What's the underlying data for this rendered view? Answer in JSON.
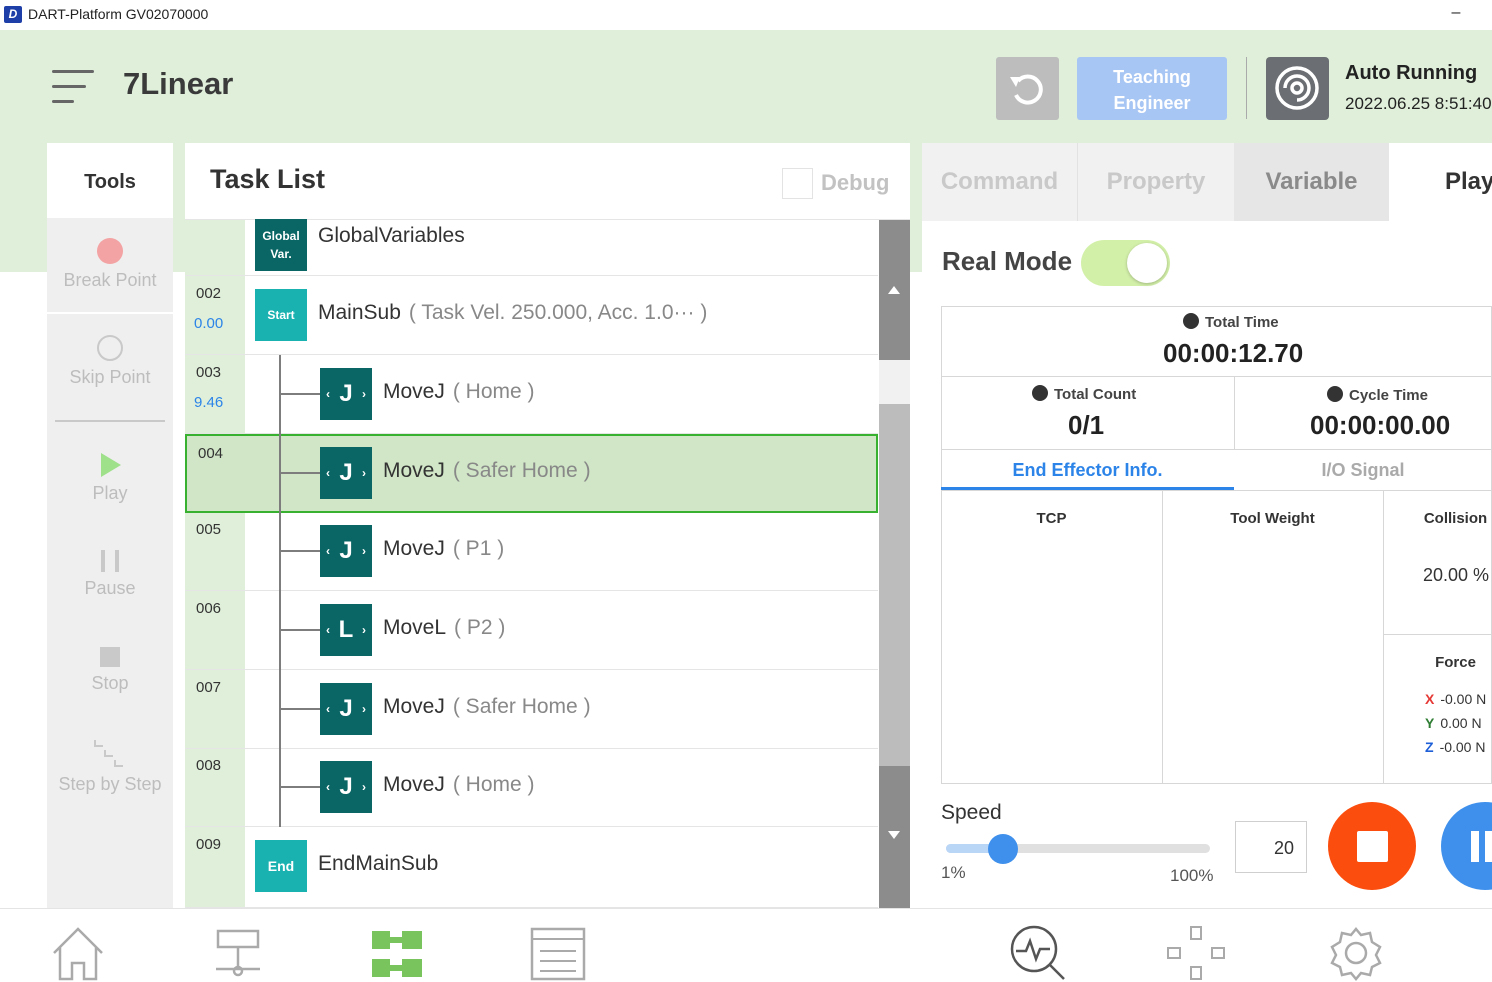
{
  "window": {
    "logo": "D",
    "title": "DART-Platform GV02070000",
    "minimize_label": "–"
  },
  "header": {
    "program_title": "7Linear",
    "teaching_label": "Teaching\nEngineer",
    "status_title": "Auto Running",
    "status_time": "2022.06.25 8:51:40"
  },
  "tools": {
    "title": "Tools",
    "items": [
      {
        "label": "Break Point",
        "icon": "break-point-icon"
      },
      {
        "label": "Skip Point",
        "icon": "skip-point-icon"
      },
      {
        "label": "Play",
        "icon": "play-icon"
      },
      {
        "label": "Pause",
        "icon": "pause-icon"
      },
      {
        "label": "Stop",
        "icon": "stop-icon"
      },
      {
        "label": "Step by Step",
        "icon": "step-by-step-icon"
      }
    ]
  },
  "task_list": {
    "title": "Task List",
    "debug_label": "Debug",
    "rows": [
      {
        "num": "",
        "value": "",
        "icon_text": "Global\nVar.",
        "icon_color": "#0a6665",
        "name": "GlobalVariables",
        "args": ""
      },
      {
        "num": "002",
        "value": "0.00",
        "icon_text": "Start",
        "icon_color": "#19b2b0",
        "name": "MainSub",
        "args": "( Task Vel. 250.000, Acc. 1.0··· )"
      },
      {
        "num": "003",
        "value": "9.46",
        "icon_text": "J",
        "icon_color": "#0a6665",
        "name": "MoveJ",
        "args": "( Home )"
      },
      {
        "num": "004",
        "value": "",
        "icon_text": "J",
        "icon_color": "#0a6665",
        "name": "MoveJ",
        "args": "( Safer Home )"
      },
      {
        "num": "005",
        "value": "",
        "icon_text": "J",
        "icon_color": "#0a6665",
        "name": "MoveJ",
        "args": "( P1 )"
      },
      {
        "num": "006",
        "value": "",
        "icon_text": "L",
        "icon_color": "#0a6665",
        "name": "MoveL",
        "args": "( P2 )"
      },
      {
        "num": "007",
        "value": "",
        "icon_text": "J",
        "icon_color": "#0a6665",
        "name": "MoveJ",
        "args": "( Safer Home )"
      },
      {
        "num": "008",
        "value": "",
        "icon_text": "J",
        "icon_color": "#0a6665",
        "name": "MoveJ",
        "args": "( Home )"
      },
      {
        "num": "009",
        "value": "",
        "icon_text": "End",
        "icon_color": "#19b2b0",
        "name": "EndMainSub",
        "args": ""
      }
    ],
    "selected_row": "004"
  },
  "right_panel": {
    "tabs": [
      "Command",
      "Property",
      "Variable",
      "Play"
    ],
    "active_tab": "Play",
    "real_mode_label": "Real Mode",
    "real_mode_on": true,
    "total_time_label": "Total Time",
    "total_time": "00:00:12.70",
    "total_count_label": "Total Count",
    "total_count": "0/1",
    "cycle_time_label": "Cycle Time",
    "cycle_time": "00:00:00.00",
    "ee_tab": "End Effector Info.",
    "io_tab": "I/O Signal",
    "tcp_label": "TCP",
    "tool_weight_label": "Tool Weight",
    "collision_label": "Collision",
    "collision_value": "20.00 %",
    "force_label": "Force",
    "force": [
      {
        "axis": "X",
        "value": "-0.00 N",
        "color": "#e53935"
      },
      {
        "axis": "Y",
        "value": "0.00 N",
        "color": "#2e7d32"
      },
      {
        "axis": "Z",
        "value": "-0.00 N",
        "color": "#1e5fd8"
      }
    ],
    "speed_label": "Speed",
    "speed_min": "1%",
    "speed_max": "100%",
    "speed_value": "20"
  },
  "bottom_nav": [
    "home-icon",
    "workcell-icon",
    "task-builder-icon",
    "task-writer-icon",
    "monitoring-icon",
    "jog-icon",
    "settings-icon"
  ],
  "colors": {
    "accent_green": "#dfefd9",
    "teal": "#0a6665",
    "blue": "#3f90ec",
    "stop_red": "#fb4d0d",
    "selected_row": "#d0e6c6",
    "selected_border": "#37b12f"
  }
}
